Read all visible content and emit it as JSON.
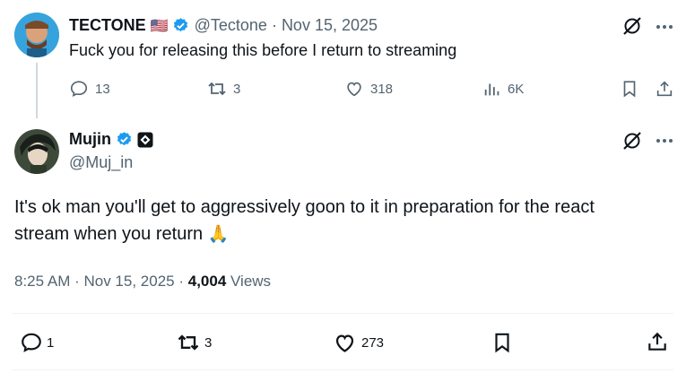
{
  "reply": {
    "author_name": "TECTONE",
    "flag": "🇺🇸",
    "handle": "@Tectone",
    "separator": "·",
    "date": "Nov 15, 2025",
    "text": "Fuck you for releasing this before I return to streaming",
    "stats": {
      "replies": "13",
      "reposts": "3",
      "likes": "318",
      "views": "6K"
    }
  },
  "main": {
    "author_name": "Mujin",
    "handle": "@Muj_in",
    "text_line1": "It's ok man you'll get to aggressively goon to it in preparation for the react",
    "text_line2": "stream when you return",
    "emoji": "🙏",
    "timestamp": "8:25 AM · Nov 15, 2025 ·",
    "views_count": "4,004",
    "views_label": "Views",
    "stats": {
      "replies": "1",
      "reposts": "3",
      "likes": "273"
    }
  },
  "colors": {
    "verified": "#1d9bf0",
    "text": "#0f1419",
    "secondary": "#536471"
  },
  "icons": [
    "grok-icon",
    "more-icon",
    "reply-icon",
    "repost-icon",
    "like-icon",
    "views-icon",
    "bookmark-icon",
    "share-icon",
    "verified-badge-icon",
    "affiliate-badge-icon"
  ]
}
